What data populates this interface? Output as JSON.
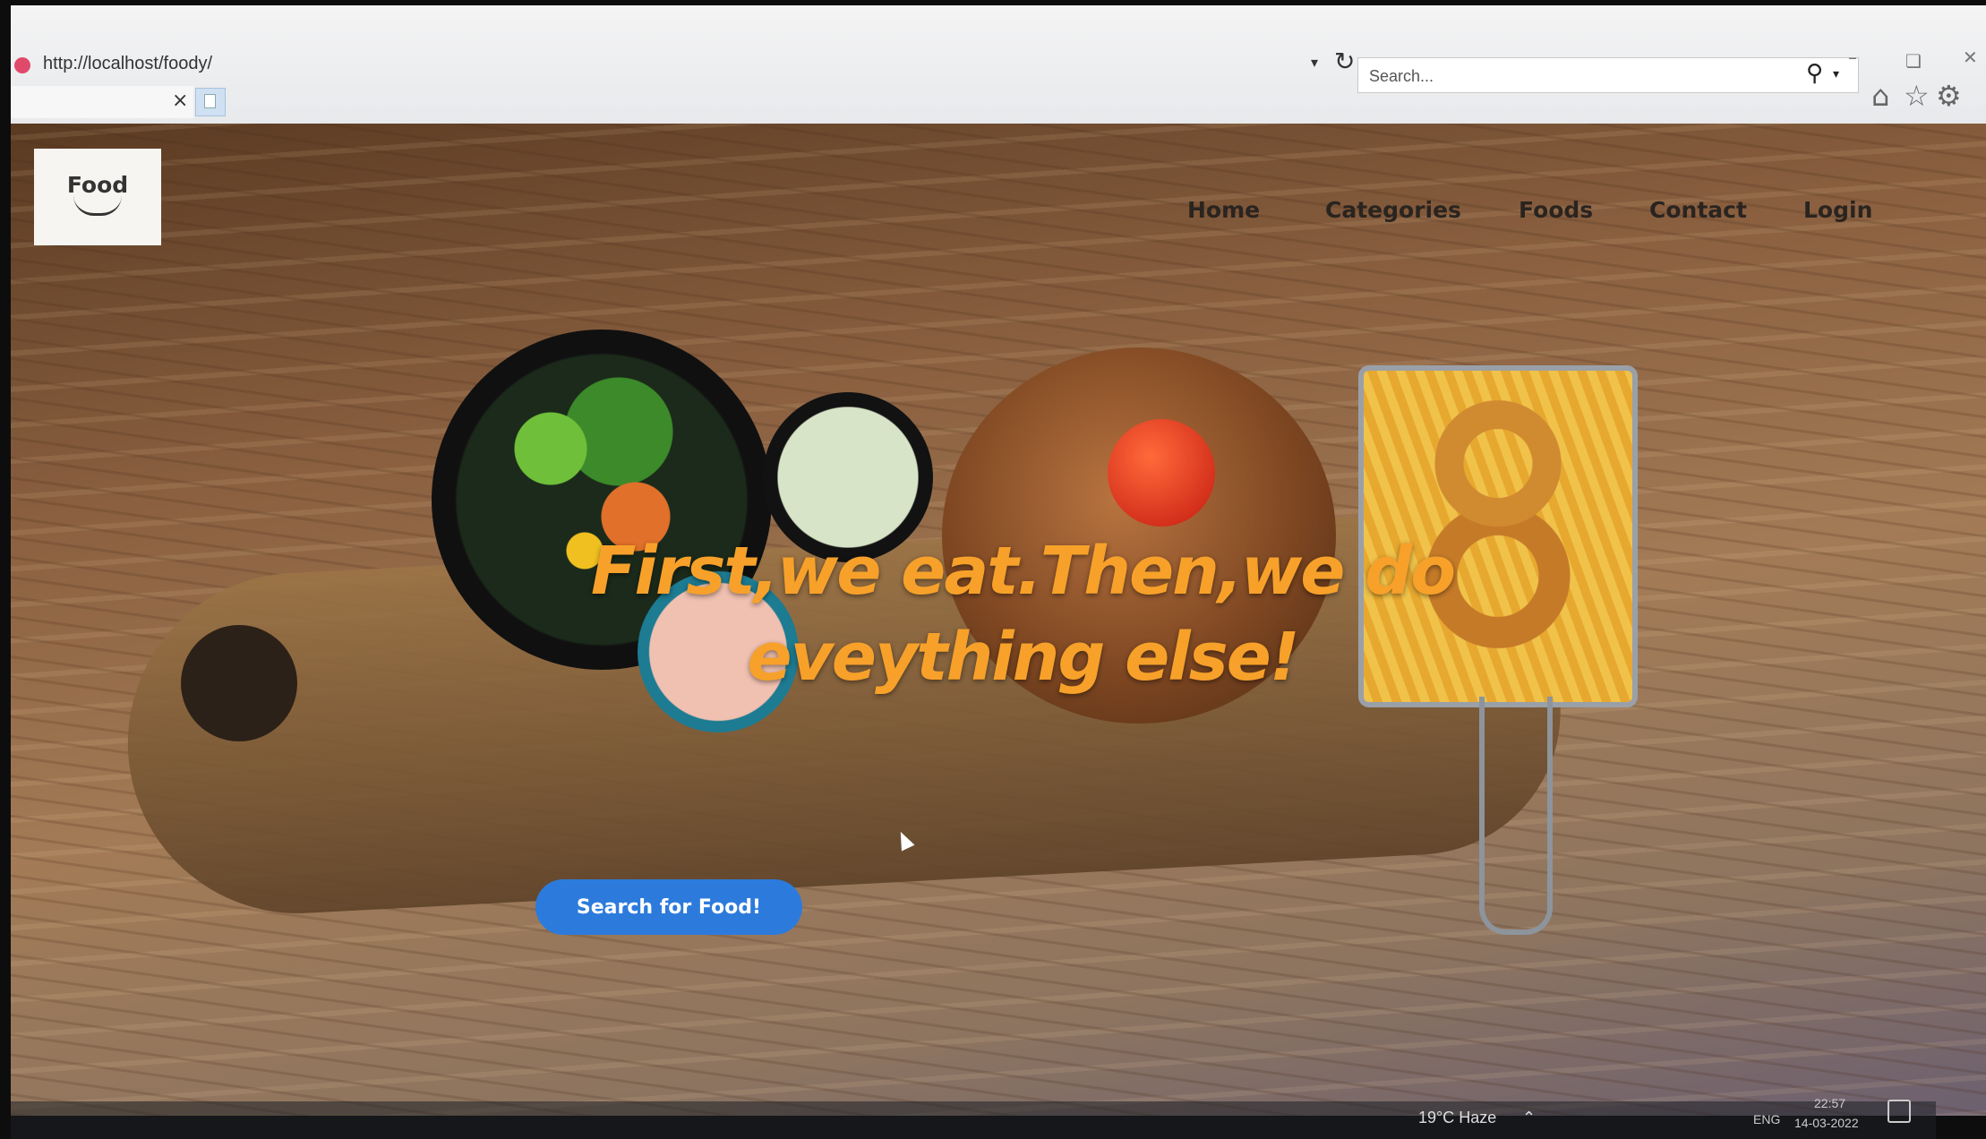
{
  "browser": {
    "url": "http://localhost/foody/",
    "search_placeholder": "Search...",
    "tab_close": "×"
  },
  "site": {
    "logo_text": "Food",
    "nav": [
      "Home",
      "Categories",
      "Foods",
      "Contact",
      "Login"
    ],
    "hero_line1": "First,we eat.Then,we do",
    "hero_line2": "eveything else!",
    "cta_label": "Search for Food!"
  },
  "taskbar": {
    "weather": "19°C  Haze",
    "language": "ENG",
    "time": "22:57",
    "date": "14-03-2022"
  },
  "colors": {
    "hero_text": "#f7a12a",
    "cta_bg": "#2c7bdc"
  }
}
